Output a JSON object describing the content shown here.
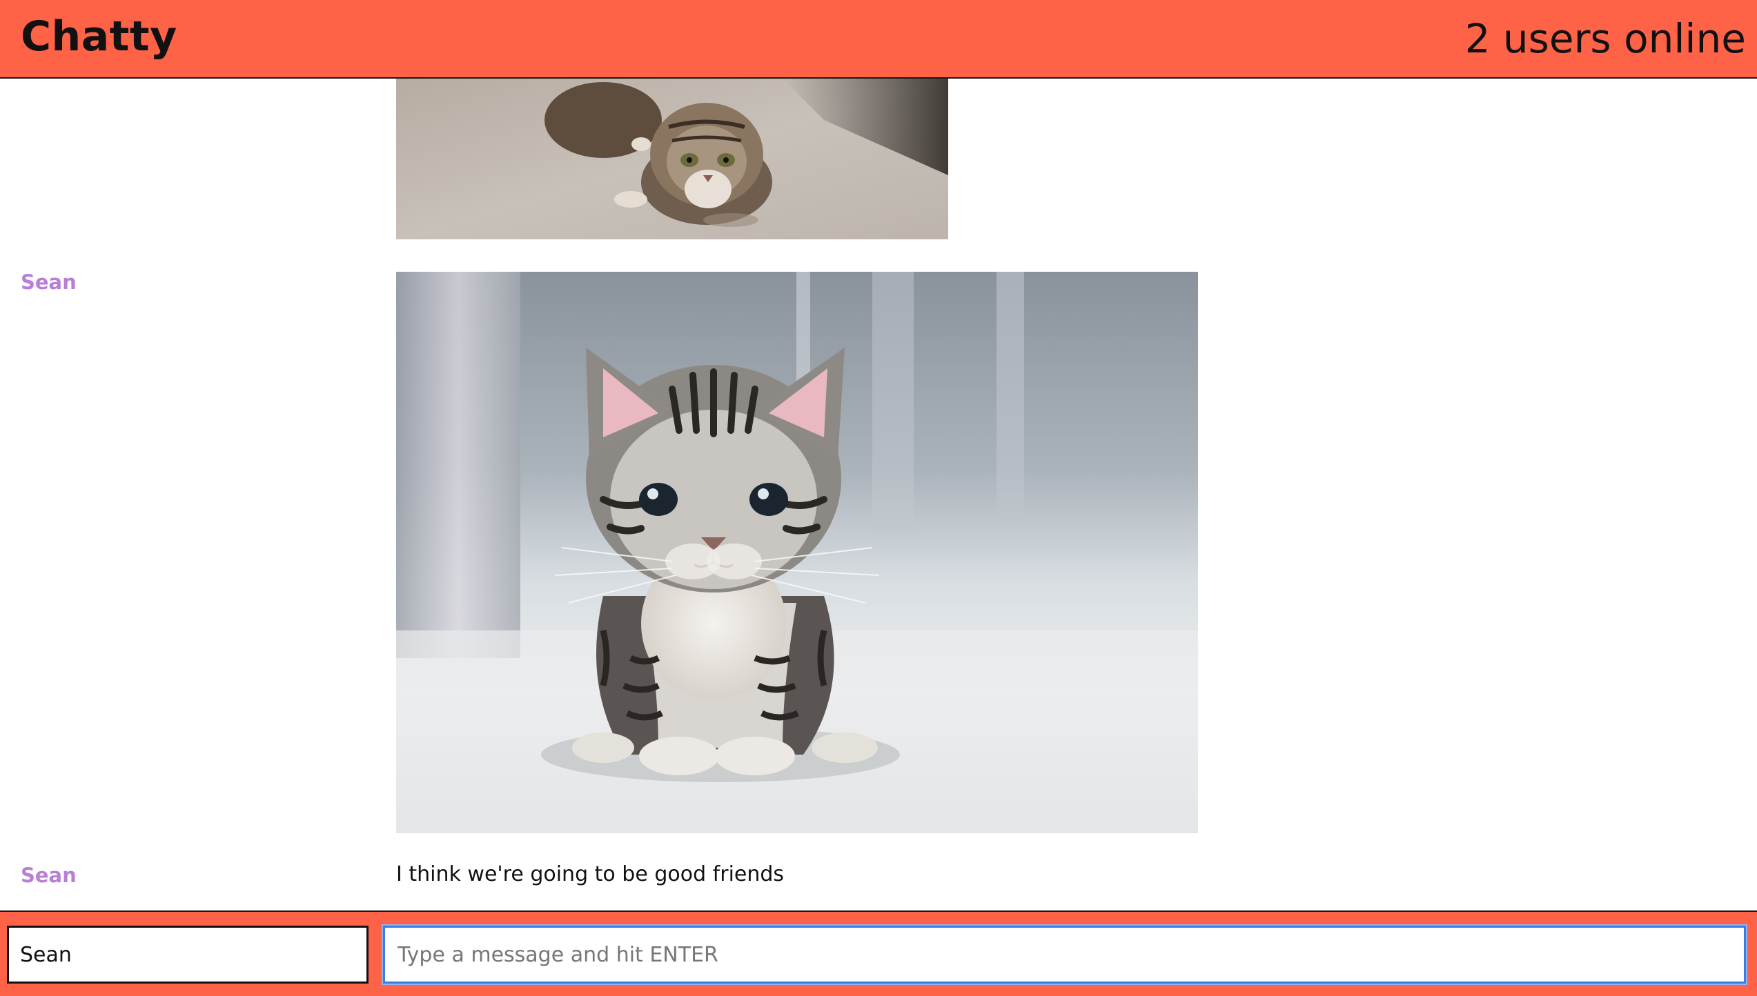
{
  "header": {
    "brand": "Chatty",
    "users_online": "2 users online"
  },
  "messages": [
    {
      "username": "",
      "type": "image",
      "image_alt": "kitten crouching on floor"
    },
    {
      "username": "Sean",
      "type": "image",
      "image_alt": "tabby kitten sitting"
    },
    {
      "username": "Sean",
      "type": "text",
      "text": "I think we're going to be good friends"
    }
  ],
  "composer": {
    "name_value": "Sean",
    "message_placeholder": "Type a message and hit ENTER",
    "message_value": ""
  },
  "colors": {
    "accent": "#ff6347",
    "username": "#b97fd6",
    "focus_border": "#3c7be0"
  }
}
